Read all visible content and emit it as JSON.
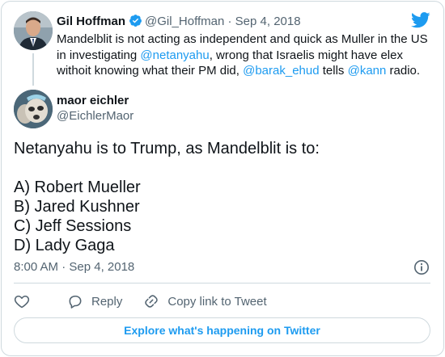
{
  "quoted_tweet": {
    "name": "Gil Hoffman",
    "handle": "@Gil_Hoffman",
    "separator": "·",
    "date": "Sep 4, 2018",
    "text_parts": [
      "Mandelblit is not acting as independent and quick as Muller in the US in investigating ",
      "@netanyahu",
      ", wrong that Israelis might have elex withoit knowing what their PM did, ",
      "@barak_ehud",
      " tells ",
      "@kann",
      " radio."
    ]
  },
  "tweet": {
    "author_name": "maor eichler",
    "author_handle": "@EichlerMaor",
    "lines": [
      "Netanyahu is to Trump, as Mandelblit is to:",
      "A) Robert Mueller",
      "B) Jared Kushner",
      "C) Jeff Sessions",
      "D) Lady Gaga"
    ],
    "timestamp": "8:00 AM · Sep 4, 2018"
  },
  "actions": {
    "reply_label": "Reply",
    "copy_link_label": "Copy link to Tweet"
  },
  "explore_label": "Explore what's happening on Twitter",
  "icons": {
    "verified": "verified-badge-icon",
    "logo": "twitter-bird-icon",
    "info": "info-icon",
    "like": "heart-icon",
    "reply": "reply-bubble-icon",
    "copy": "link-icon"
  },
  "colors": {
    "accent": "#1d9bf0",
    "text": "#0f1419",
    "muted": "#536471",
    "border": "#cfd9de"
  }
}
